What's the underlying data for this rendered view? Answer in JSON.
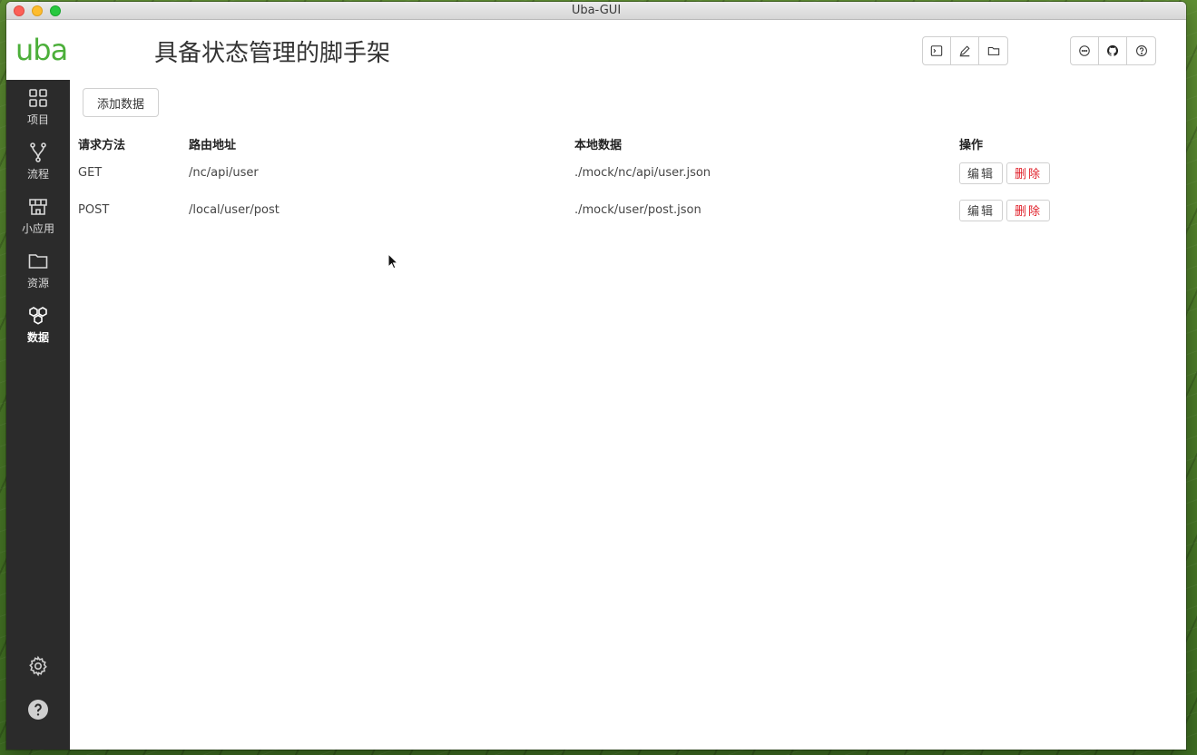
{
  "window": {
    "title": "Uba-GUI"
  },
  "header": {
    "logo": "uba",
    "heading": "具备状态管理的脚手架",
    "tools_left": [
      {
        "icon": "terminal-icon"
      },
      {
        "icon": "edit-icon"
      },
      {
        "icon": "folder-icon"
      }
    ],
    "tools_right": [
      {
        "icon": "chat-icon"
      },
      {
        "icon": "github-icon"
      },
      {
        "icon": "help-circle-icon"
      }
    ]
  },
  "sidebar": {
    "items": [
      {
        "label": "项目",
        "icon": "grid-icon",
        "active": false
      },
      {
        "label": "流程",
        "icon": "flow-branch-icon",
        "active": false
      },
      {
        "label": "小应用",
        "icon": "mini-app-icon",
        "active": false
      },
      {
        "label": "资源",
        "icon": "folder-icon",
        "active": false
      },
      {
        "label": "数据",
        "icon": "data-hexagons-icon",
        "active": true
      }
    ],
    "bottom": [
      {
        "icon": "settings-gear-icon"
      },
      {
        "icon": "help-icon"
      }
    ]
  },
  "main": {
    "add_button": "添加数据",
    "table": {
      "headers": [
        "请求方法",
        "路由地址",
        "本地数据",
        "操作"
      ],
      "rows": [
        {
          "method": "GET",
          "route": "/nc/api/user",
          "local": "./mock/nc/api/user.json"
        },
        {
          "method": "POST",
          "route": "/local/user/post",
          "local": "./mock/user/post.json"
        }
      ],
      "actions": {
        "edit": "编辑",
        "delete": "删除"
      }
    }
  },
  "colors": {
    "brand": "#4caf3a",
    "sidebar": "#2b2b2b",
    "danger": "#e0202a"
  }
}
